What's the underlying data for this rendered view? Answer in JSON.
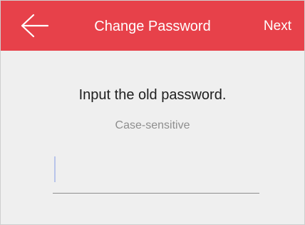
{
  "header": {
    "back_icon": "arrow-left-icon",
    "title": "Change Password",
    "next_label": "Next"
  },
  "main": {
    "prompt": "Input the old password.",
    "hint": "Case-sensitive",
    "password_input": {
      "value": "",
      "placeholder": ""
    }
  },
  "colors": {
    "header_background": "#e7414a",
    "page_background": "#efefef",
    "caret": "#b8c4ea"
  }
}
